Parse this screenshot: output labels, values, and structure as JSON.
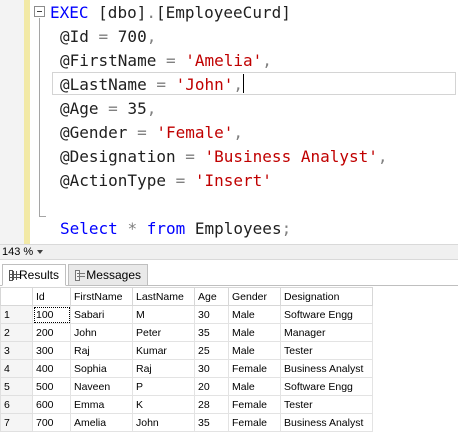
{
  "editor": {
    "lines": [
      [
        {
          "t": "EXEC ",
          "c": "kw"
        },
        {
          "t": "[dbo]",
          "c": "id"
        },
        {
          "t": ".",
          "c": "op"
        },
        {
          "t": "[EmployeeCurd]",
          "c": "id"
        }
      ],
      [
        {
          "t": "@Id ",
          "c": "id"
        },
        {
          "t": "= ",
          "c": "op"
        },
        {
          "t": "700",
          "c": "id"
        },
        {
          "t": ",",
          "c": "op"
        }
      ],
      [
        {
          "t": "@FirstName ",
          "c": "id"
        },
        {
          "t": "= ",
          "c": "op"
        },
        {
          "t": "'Amelia'",
          "c": "str"
        },
        {
          "t": ",",
          "c": "op"
        }
      ],
      [
        {
          "t": "@LastName ",
          "c": "id"
        },
        {
          "t": "= ",
          "c": "op"
        },
        {
          "t": "'John'",
          "c": "str"
        },
        {
          "t": ",",
          "c": "op"
        }
      ],
      [
        {
          "t": "@Age ",
          "c": "id"
        },
        {
          "t": "= ",
          "c": "op"
        },
        {
          "t": "35",
          "c": "id"
        },
        {
          "t": ",",
          "c": "op"
        }
      ],
      [
        {
          "t": "@Gender ",
          "c": "id"
        },
        {
          "t": "= ",
          "c": "op"
        },
        {
          "t": "'Female'",
          "c": "str"
        },
        {
          "t": ",",
          "c": "op"
        }
      ],
      [
        {
          "t": "@Designation ",
          "c": "id"
        },
        {
          "t": "= ",
          "c": "op"
        },
        {
          "t": "'Business Analyst'",
          "c": "str"
        },
        {
          "t": ",",
          "c": "op"
        }
      ],
      [
        {
          "t": "@ActionType ",
          "c": "id"
        },
        {
          "t": "= ",
          "c": "op"
        },
        {
          "t": "'Insert'",
          "c": "str"
        }
      ],
      [],
      [
        {
          "t": "Select ",
          "c": "kw"
        },
        {
          "t": "* ",
          "c": "op"
        },
        {
          "t": "from ",
          "c": "kw"
        },
        {
          "t": "Employees",
          "c": "id"
        },
        {
          "t": ";",
          "c": "op"
        }
      ]
    ]
  },
  "status": {
    "zoom": "143 %"
  },
  "results": {
    "tabs": [
      {
        "label": "Results",
        "active": true
      },
      {
        "label": "Messages",
        "active": false
      }
    ],
    "columns": [
      "Id",
      "FirstName",
      "LastName",
      "Age",
      "Gender",
      "Designation"
    ],
    "rows": [
      [
        "1",
        "100",
        "Sabari",
        "M",
        "30",
        "Male",
        "Software Engg"
      ],
      [
        "2",
        "200",
        "John",
        "Peter",
        "35",
        "Male",
        "Manager"
      ],
      [
        "3",
        "300",
        "Raj",
        "Kumar",
        "25",
        "Male",
        "Tester"
      ],
      [
        "4",
        "400",
        "Sophia",
        "Raj",
        "30",
        "Female",
        "Business Analyst"
      ],
      [
        "5",
        "500",
        "Naveen",
        "P",
        "20",
        "Male",
        "Software Engg"
      ],
      [
        "6",
        "600",
        "Emma",
        "K",
        "28",
        "Female",
        "Tester"
      ],
      [
        "7",
        "700",
        "Amelia",
        "John",
        "35",
        "Female",
        "Business Analyst"
      ]
    ]
  },
  "colors": {
    "keyword": "#0000ff",
    "string": "#c00000",
    "operator": "#808080"
  }
}
